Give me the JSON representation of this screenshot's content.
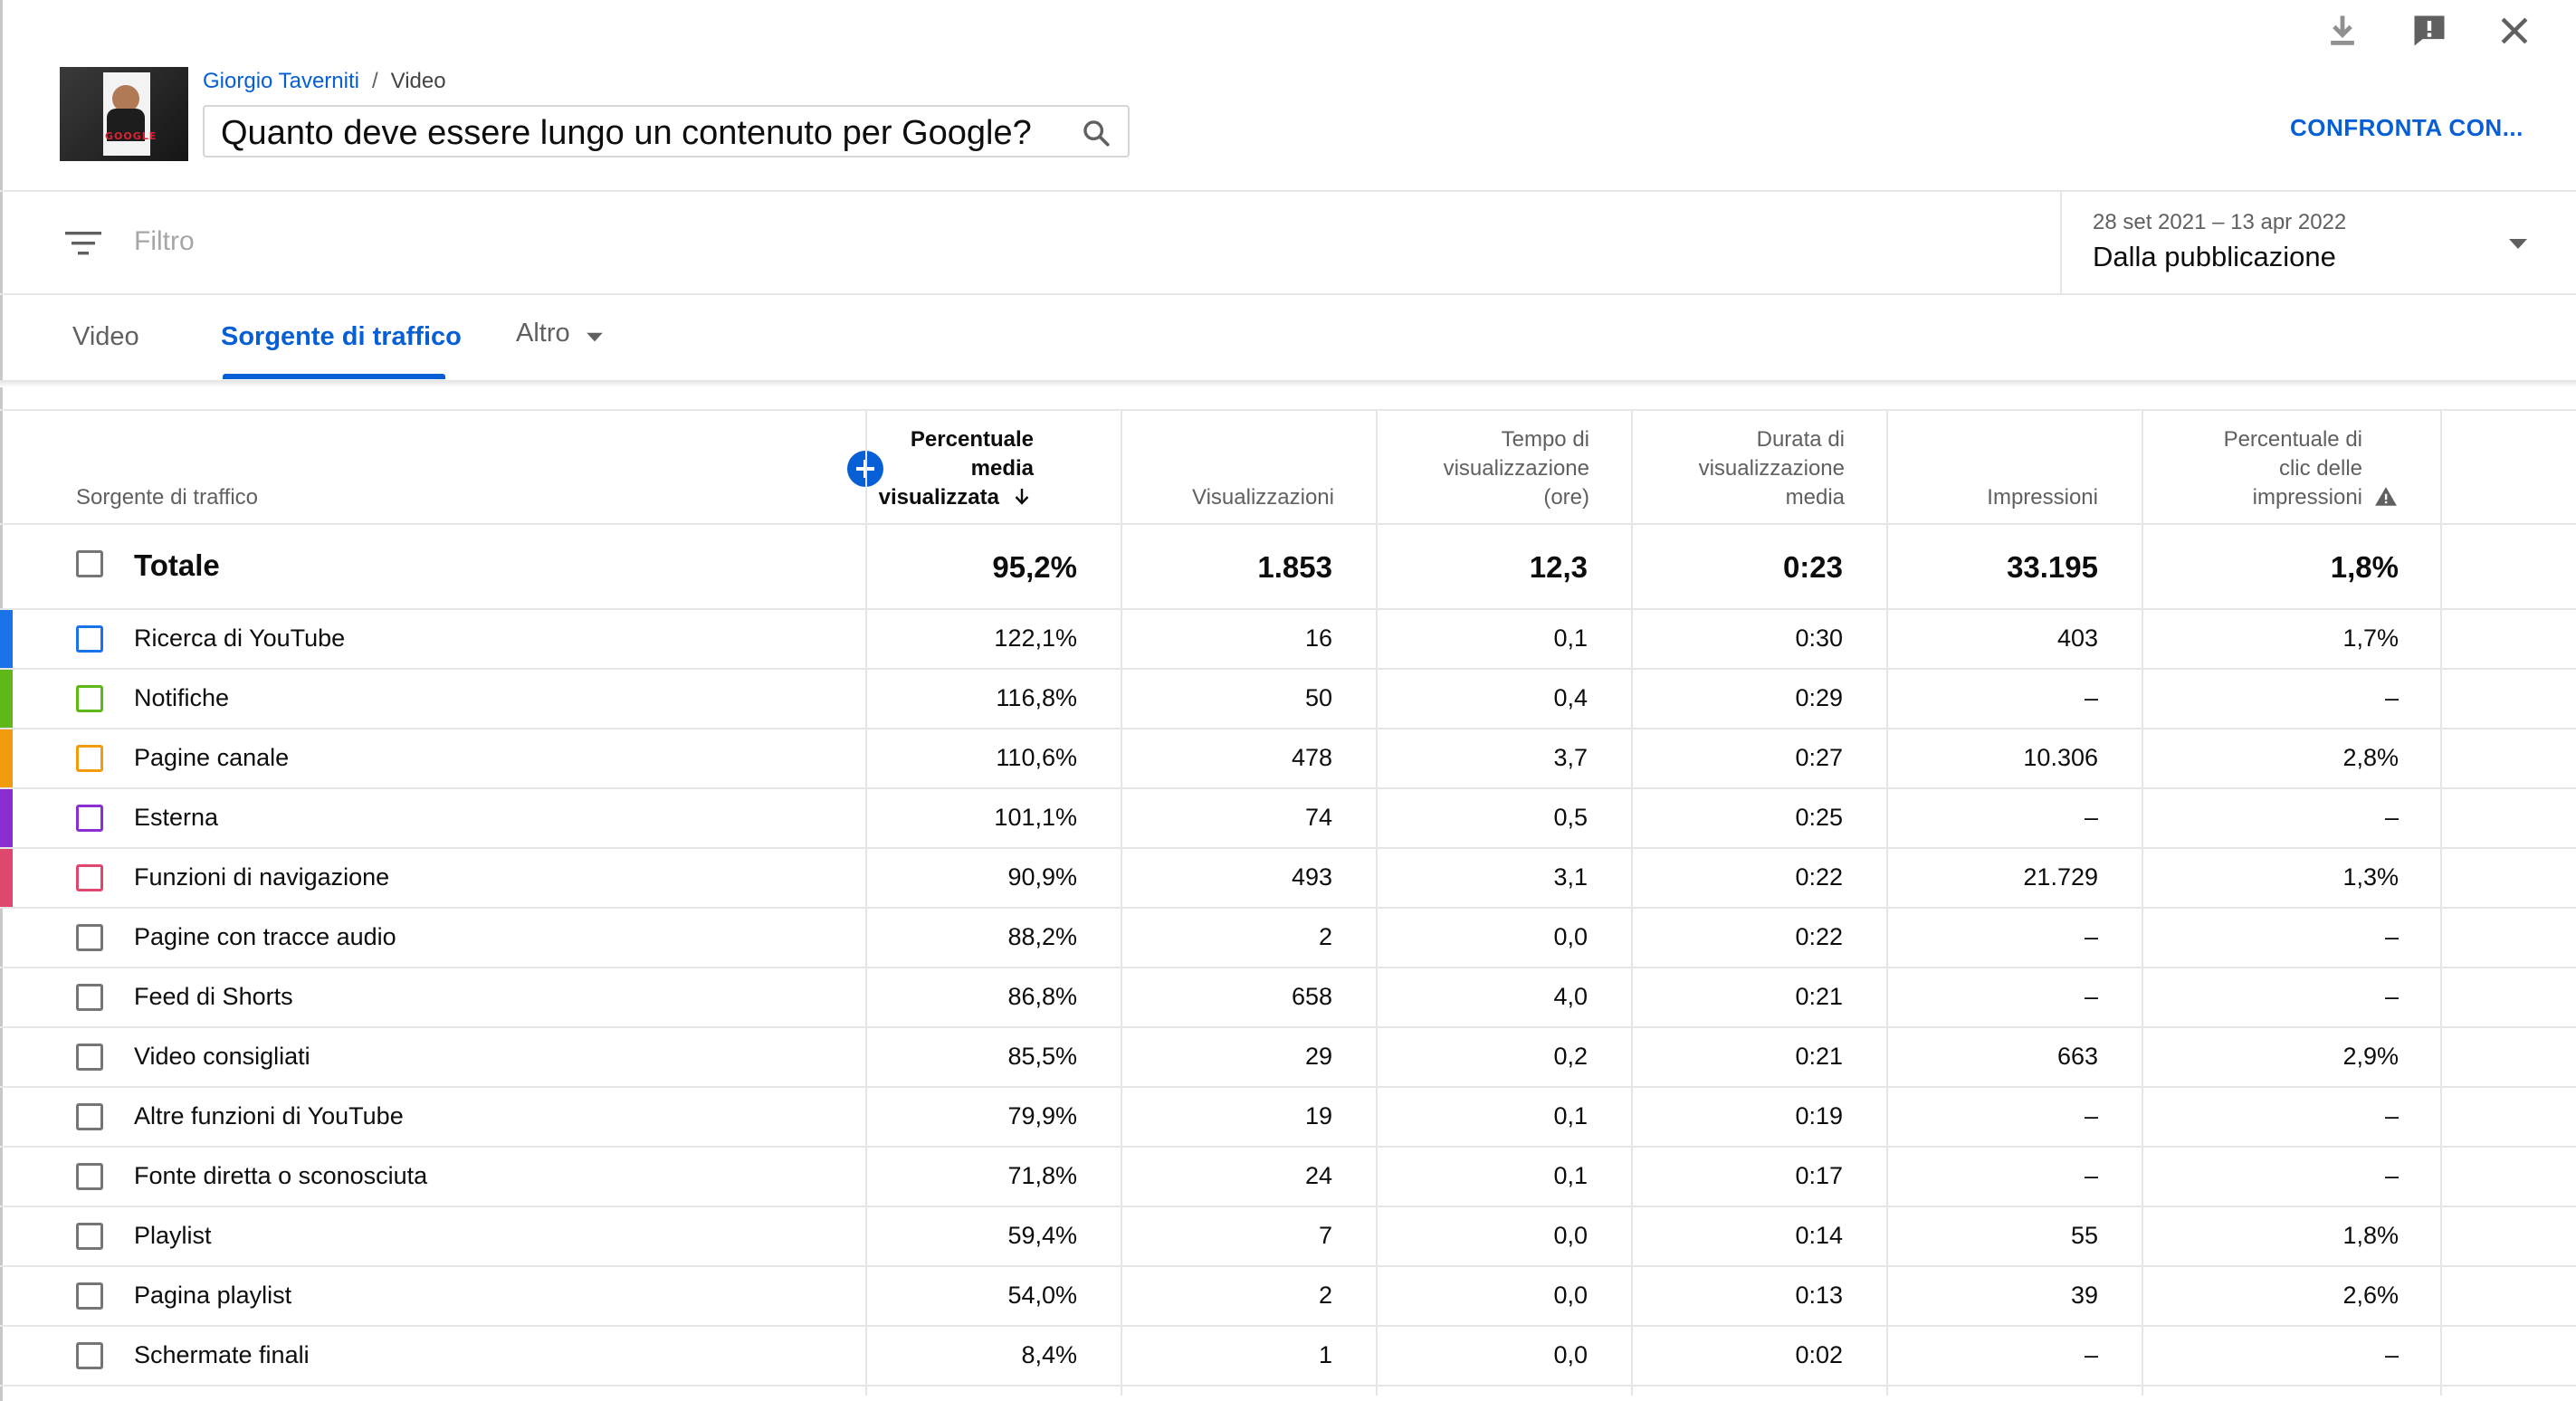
{
  "header": {
    "channel": "Giorgio Taverniti",
    "separator": "/",
    "section": "Video",
    "video_title": "Quanto deve essere lungo un contenuto per Google?",
    "thumbnail_text": "GOOGLE",
    "compare_label": "CONFRONTA CON..."
  },
  "filter": {
    "placeholder": "Filtro",
    "date_range": "28 set 2021 – 13 apr 2022",
    "date_label": "Dalla pubblicazione"
  },
  "tabs": [
    {
      "label": "Video",
      "active": false
    },
    {
      "label": "Sorgente di traffico",
      "active": true
    },
    {
      "label": "Altro",
      "active": false
    }
  ],
  "table": {
    "headers": {
      "source": "Sorgente di traffico",
      "avg_pct": [
        "Percentuale",
        "media",
        "visualizzata"
      ],
      "views": "Visualizzazioni",
      "watch_time": [
        "Tempo di",
        "visualizzazione",
        "(ore)"
      ],
      "avg_duration": [
        "Durata di",
        "visualizzazione",
        "media"
      ],
      "impressions": "Impressioni",
      "ctr": [
        "Percentuale di",
        "clic delle",
        "impressioni"
      ]
    },
    "total": {
      "label": "Totale",
      "avg_pct": "95,2%",
      "views": "1.853",
      "watch_time": "12,3",
      "avg_duration": "0:23",
      "impressions": "33.195",
      "ctr": "1,8%"
    },
    "rows": [
      {
        "label": "Ricerca di YouTube",
        "avg_pct": "122,1%",
        "views": "16",
        "watch_time": "0,1",
        "avg_duration": "0:30",
        "impressions": "403",
        "ctr": "1,7%",
        "color": "#1a73e8"
      },
      {
        "label": "Notifiche",
        "avg_pct": "116,8%",
        "views": "50",
        "watch_time": "0,4",
        "avg_duration": "0:29",
        "impressions": "–",
        "ctr": "–",
        "color": "#5eb817"
      },
      {
        "label": "Pagine canale",
        "avg_pct": "110,6%",
        "views": "478",
        "watch_time": "3,7",
        "avg_duration": "0:27",
        "impressions": "10.306",
        "ctr": "2,8%",
        "color": "#f29b0e"
      },
      {
        "label": "Esterna",
        "avg_pct": "101,1%",
        "views": "74",
        "watch_time": "0,5",
        "avg_duration": "0:25",
        "impressions": "–",
        "ctr": "–",
        "color": "#8a2dd1"
      },
      {
        "label": "Funzioni di navigazione",
        "avg_pct": "90,9%",
        "views": "493",
        "watch_time": "3,1",
        "avg_duration": "0:22",
        "impressions": "21.729",
        "ctr": "1,3%",
        "color": "#e0476e"
      },
      {
        "label": "Pagine con tracce audio",
        "avg_pct": "88,2%",
        "views": "2",
        "watch_time": "0,0",
        "avg_duration": "0:22",
        "impressions": "–",
        "ctr": "–",
        "color": ""
      },
      {
        "label": "Feed di Shorts",
        "avg_pct": "86,8%",
        "views": "658",
        "watch_time": "4,0",
        "avg_duration": "0:21",
        "impressions": "–",
        "ctr": "–",
        "color": ""
      },
      {
        "label": "Video consigliati",
        "avg_pct": "85,5%",
        "views": "29",
        "watch_time": "0,2",
        "avg_duration": "0:21",
        "impressions": "663",
        "ctr": "2,9%",
        "color": ""
      },
      {
        "label": "Altre funzioni di YouTube",
        "avg_pct": "79,9%",
        "views": "19",
        "watch_time": "0,1",
        "avg_duration": "0:19",
        "impressions": "–",
        "ctr": "–",
        "color": ""
      },
      {
        "label": "Fonte diretta o sconosciuta",
        "avg_pct": "71,8%",
        "views": "24",
        "watch_time": "0,1",
        "avg_duration": "0:17",
        "impressions": "–",
        "ctr": "–",
        "color": ""
      },
      {
        "label": "Playlist",
        "avg_pct": "59,4%",
        "views": "7",
        "watch_time": "0,0",
        "avg_duration": "0:14",
        "impressions": "55",
        "ctr": "1,8%",
        "color": ""
      },
      {
        "label": "Pagina playlist",
        "avg_pct": "54,0%",
        "views": "2",
        "watch_time": "0,0",
        "avg_duration": "0:13",
        "impressions": "39",
        "ctr": "2,6%",
        "color": ""
      },
      {
        "label": "Schermate finali",
        "avg_pct": "8,4%",
        "views": "1",
        "watch_time": "0,0",
        "avg_duration": "0:02",
        "impressions": "–",
        "ctr": "–",
        "color": ""
      }
    ]
  },
  "icons": {
    "download": "download-icon",
    "feedback": "feedback-icon",
    "close": "close-icon",
    "search": "search-icon",
    "filter": "filter-icon",
    "sort": "sort-down-arrow-icon",
    "warning": "warning-icon",
    "add_column": "add-column-icon"
  }
}
